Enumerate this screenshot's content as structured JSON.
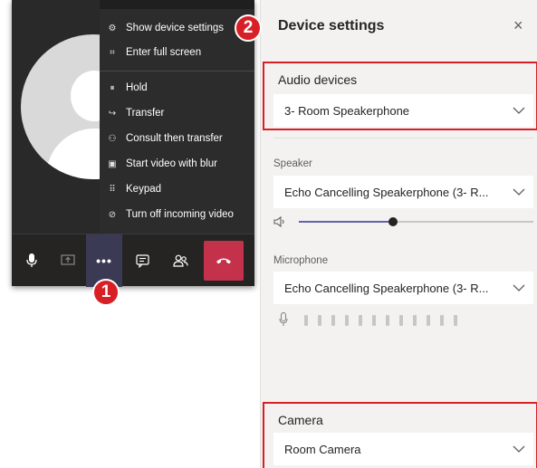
{
  "more_menu": {
    "items": [
      {
        "label": "Show device settings",
        "icon": "gear-icon"
      },
      {
        "label": "Enter full screen",
        "icon": "fullscreen-icon"
      },
      {
        "label": "Hold",
        "icon": "pause-icon"
      },
      {
        "label": "Transfer",
        "icon": "transfer-icon"
      },
      {
        "label": "Consult then transfer",
        "icon": "consult-icon"
      },
      {
        "label": "Start video with blur",
        "icon": "blur-icon"
      },
      {
        "label": "Keypad",
        "icon": "keypad-icon"
      },
      {
        "label": "Turn off incoming video",
        "icon": "video-off-icon"
      }
    ]
  },
  "toolbar": {
    "buttons": [
      {
        "name": "mic-button",
        "icon": "microphone-icon"
      },
      {
        "name": "share-button",
        "icon": "share-screen-icon"
      },
      {
        "name": "more-actions-button",
        "icon": "ellipsis-icon",
        "label": "•••"
      },
      {
        "name": "chat-button",
        "icon": "chat-icon"
      },
      {
        "name": "participants-button",
        "icon": "people-icon"
      },
      {
        "name": "hang-up-button",
        "icon": "phone-hangup-icon"
      }
    ]
  },
  "badges": {
    "one": "1",
    "two": "2"
  },
  "panel": {
    "title": "Device settings",
    "close_glyph": "×",
    "audio": {
      "label": "Audio devices",
      "value": "3- Room Speakerphone"
    },
    "speaker": {
      "label": "Speaker",
      "value": "Echo Cancelling Speakerphone (3- R..."
    },
    "speaker_volume": 0.4,
    "microphone": {
      "label": "Microphone",
      "value": "Echo Cancelling Speakerphone (3- R..."
    },
    "mic_level_bars": 12,
    "camera": {
      "label": "Camera",
      "value": "Room Camera"
    }
  },
  "colors": {
    "accent": "#6264a7",
    "highlight_red": "#d81f26",
    "hangup_red": "#c4314b",
    "menu_bg": "#2d2c2c",
    "panel_bg": "#f3f2f1"
  }
}
